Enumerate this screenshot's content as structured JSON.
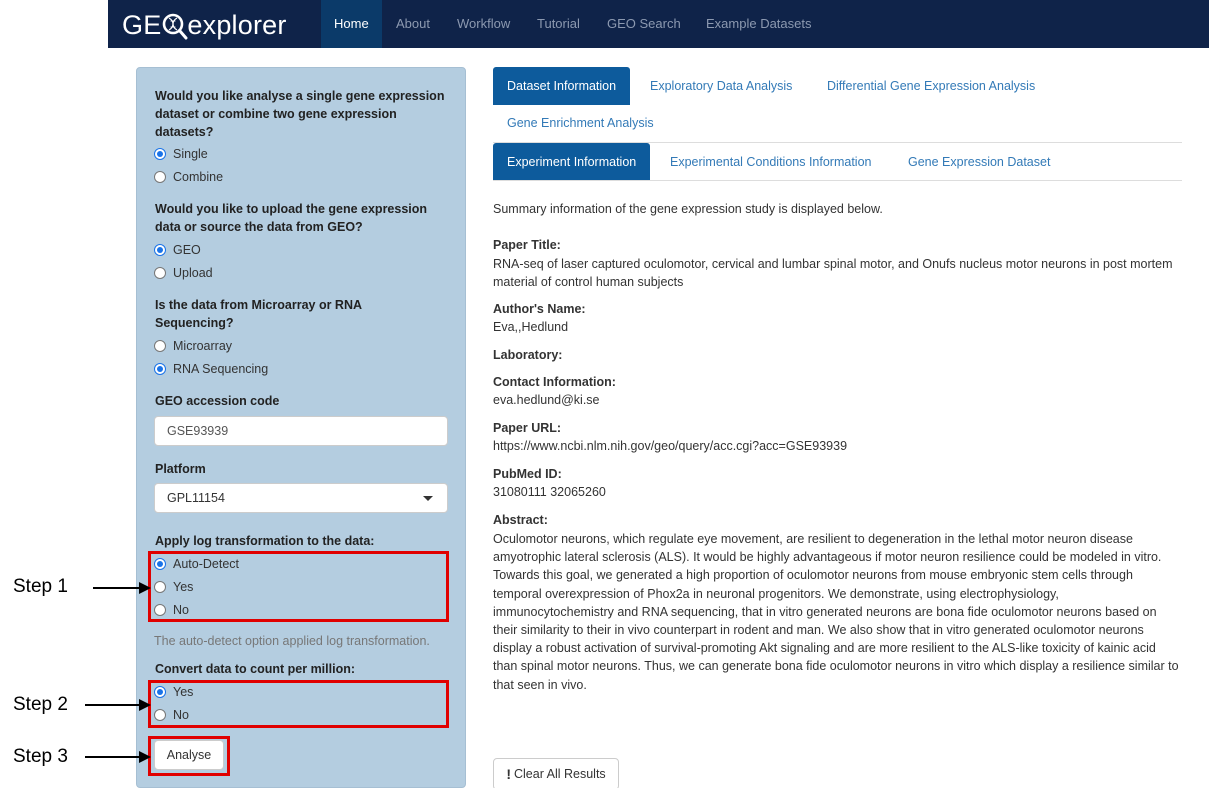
{
  "navbar": {
    "brand_prefix": "GE",
    "brand_suffix": "explorer",
    "items": [
      "Home",
      "About",
      "Workflow",
      "Tutorial",
      "GEO Search",
      "Example Datasets"
    ],
    "active": "Home",
    "bg_color": "#0f2349",
    "active_color": "#0b3a69"
  },
  "sidebar": {
    "bg_color": "#b4cde0",
    "q1": "Would you like analyse a single gene expression dataset or combine two gene expression datasets?",
    "q1_options": [
      "Single",
      "Combine"
    ],
    "q1_selected": "Single",
    "q2": "Would you like to upload the gene expression data or source the data from GEO?",
    "q2_options": [
      "GEO",
      "Upload"
    ],
    "q2_selected": "GEO",
    "q3": "Is the data from Microarray or RNA Sequencing?",
    "q3_options": [
      "Microarray",
      "RNA Sequencing"
    ],
    "q3_selected": "RNA Sequencing",
    "geo_label": "GEO accession code",
    "geo_value": "GSE93939",
    "platform_label": "Platform",
    "platform_value": "GPL11154",
    "log_label": "Apply log transformation to the data:",
    "log_options": [
      "Auto-Detect",
      "Yes",
      "No"
    ],
    "log_selected": "Auto-Detect",
    "log_help": "The auto-detect option applied log transformation.",
    "cpm_label": "Convert data to count per million:",
    "cpm_options": [
      "Yes",
      "No"
    ],
    "cpm_selected": "Yes",
    "analyse_button": "Analyse"
  },
  "annotations": {
    "step1": "Step 1",
    "step2": "Step 2",
    "step3": "Step 3",
    "highlight_color": "#e00000"
  },
  "main": {
    "tabs": [
      "Dataset Information",
      "Exploratory Data Analysis",
      "Differential Gene Expression Analysis",
      "Gene Enrichment Analysis"
    ],
    "active_tab": "Dataset Information",
    "subtabs": [
      "Experiment Information",
      "Experimental Conditions Information",
      "Gene Expression Dataset"
    ],
    "active_subtab": "Experiment Information",
    "summary": "Summary information of the gene expression study is displayed below.",
    "paper_title_label": "Paper Title:",
    "paper_title": "RNA-seq of laser captured oculomotor, cervical and lumbar spinal motor, and Onufs nucleus motor neurons in post mortem material of control human subjects",
    "author_label": "Author's Name:",
    "author": "Eva,,Hedlund",
    "lab_label": "Laboratory:",
    "contact_label": "Contact Information:",
    "contact": "eva.hedlund@ki.se",
    "url_label": "Paper URL:",
    "url": "https://www.ncbi.nlm.nih.gov/geo/query/acc.cgi?acc=GSE93939",
    "pubmed_label": "PubMed ID:",
    "pubmed": "31080111 32065260",
    "abstract_label": "Abstract:",
    "abstract": "Oculomotor neurons, which regulate eye movement, are resilient to degeneration in the lethal motor neuron disease amyotrophic lateral sclerosis (ALS). It would be highly advantageous if motor neuron resilience could be modeled in vitro. Towards this goal, we generated a high proportion of oculomotor neurons from mouse embryonic stem cells through temporal overexpression of Phox2a in neuronal progenitors. We demonstrate, using electrophysiology, immunocytochemistry and RNA sequencing, that in vitro generated neurons are bona fide oculomotor neurons based on their similarity to their in vivo counterpart in rodent and man. We also show that in vitro generated oculomotor neurons display a robust activation of survival-promoting Akt signaling and are more resilient to the ALS-like toxicity of kainic acid than spinal motor neurons. Thus, we can generate bona fide oculomotor neurons in vitro which display a resilience similar to that seen in vivo.",
    "clear_button": "Clear All Results",
    "clear_icon": "exclamation-icon"
  }
}
